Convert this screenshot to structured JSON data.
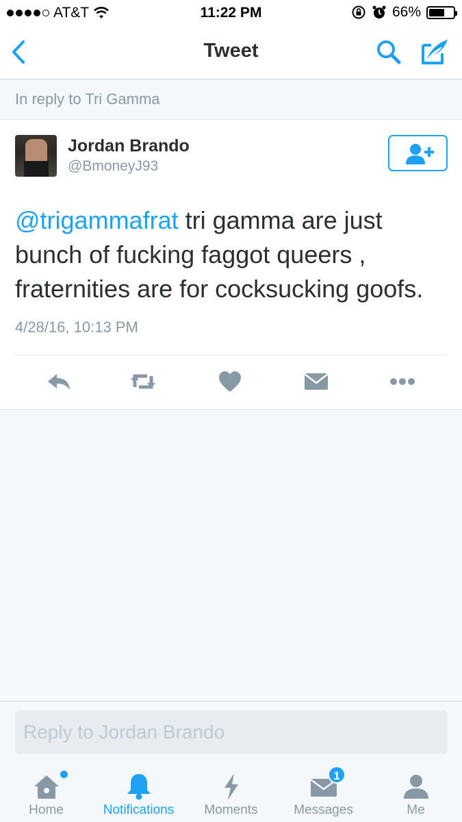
{
  "status_bar": {
    "carrier": "AT&T",
    "time": "11:22 PM",
    "battery_percent": "66%",
    "battery_level": 0.66,
    "signal_bars": 4,
    "icons": [
      "wifi-icon",
      "rotation-lock-icon",
      "alarm-icon",
      "battery-icon"
    ]
  },
  "nav": {
    "title": "Tweet",
    "icons": [
      "back-chevron-icon",
      "search-icon",
      "compose-icon"
    ]
  },
  "reply_banner": "In reply to Tri Gamma",
  "tweet": {
    "author_name": "Jordan Brando",
    "author_handle": "@BmoneyJ93",
    "mention": "@trigammafrat",
    "text": " tri gamma are just bunch of fucking faggot queers , fraternities are for cocksucking goofs.",
    "timestamp": "4/28/16, 10:13 PM",
    "actions": [
      "reply-icon",
      "retweet-icon",
      "like-icon",
      "direct-message-icon",
      "more-icon"
    ]
  },
  "reply_box": {
    "placeholder": "Reply to Jordan Brando"
  },
  "tabs": [
    {
      "label": "Home",
      "icon": "home-icon",
      "active": false,
      "dot": true
    },
    {
      "label": "Notifications",
      "icon": "bell-icon",
      "active": true
    },
    {
      "label": "Moments",
      "icon": "lightning-icon",
      "active": false
    },
    {
      "label": "Messages",
      "icon": "envelope-icon",
      "active": false,
      "badge": "1"
    },
    {
      "label": "Me",
      "icon": "person-icon",
      "active": false
    }
  ],
  "colors": {
    "accent": "#1DA1F2",
    "muted": "#8899A6",
    "text": "#292F33",
    "background": "#F5F8FA"
  }
}
